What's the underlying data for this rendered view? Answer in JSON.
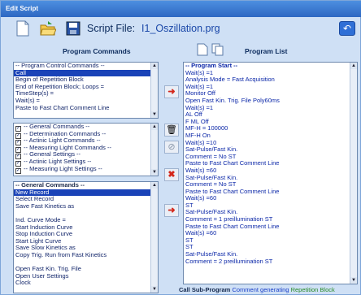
{
  "window": {
    "title": "Edit Script"
  },
  "toolbar": {
    "script_file_label": "Script File:",
    "script_file_name": "I1_Oszillation.prg",
    "icons": [
      "new-file-icon",
      "open-folder-icon",
      "save-disk-icon"
    ],
    "back_icon": "back-arrow-icon"
  },
  "headers": {
    "commands": "Program Commands",
    "list": "Program List"
  },
  "control_commands": [
    "-- Program Control Commands --",
    "Call",
    "Begin of Repetition Block",
    "End of Repetition Block; Loops =",
    "TimeStep(s) =",
    "Wait(s) =",
    "Paste to Fast Chart Comment Line"
  ],
  "categories": [
    "-- General Commands --",
    "-- Determination Commands --",
    "-- Actinic Light Commands --",
    "-- Measuring Light Commands --",
    "-- General Settings --",
    "-- Actinic Light Settings --",
    "-- Measuring Light Settings --"
  ],
  "general_commands": [
    "-- General Commands --",
    "New Record",
    "Select Record",
    "Save Fast Kinetics as",
    "",
    "Ind. Curve Mode =",
    "Start Induction Curve",
    "Stop Induction Curve",
    "Start Light Curve",
    "Save Slow Kinetics as",
    "Copy Trig. Run from Fast Kinetics",
    "",
    "Open Fast Kin. Trig. File",
    "Open User Settings",
    "Clock"
  ],
  "program_list": [
    "-- Program Start --",
    "Wait(s) =1",
    "Analysis Mode = Fast Acquisition",
    "Wait(s) =1",
    "Monitor Off",
    "Open Fast Kin. Trig. File Poly60ms",
    "Wait(s) =1",
    "AL Off",
    "F ML Off",
    "MF-H = 100000",
    "MF-H On",
    "Wait(s) =10",
    "Sat-Pulse/Fast Kin.",
    "Comment = No ST",
    "Paste to Fast Chart Comment Line",
    "Wait(s) =60",
    "Sat-Pulse/Fast Kin.",
    "Comment = No ST",
    "Paste to Fast Chart Comment Line",
    "Wait(s) =60",
    "ST",
    "Sat-Pulse/Fast Kin.",
    "Comment = 1 preillumination ST",
    "Paste to Fast Chart Comment Line",
    "Wait(s) =60",
    "ST",
    "ST",
    "Sat-Pulse/Fast Kin.",
    "Comment = 2 preillumination ST"
  ],
  "footer": {
    "call": "Call Sub-Program",
    "comment": "Comment generating",
    "repetition": "Repetition Block"
  },
  "colors": {
    "selection": "#1a43b8",
    "window_bg": "#cfe0f5",
    "arrow_red": "#d4281b"
  }
}
